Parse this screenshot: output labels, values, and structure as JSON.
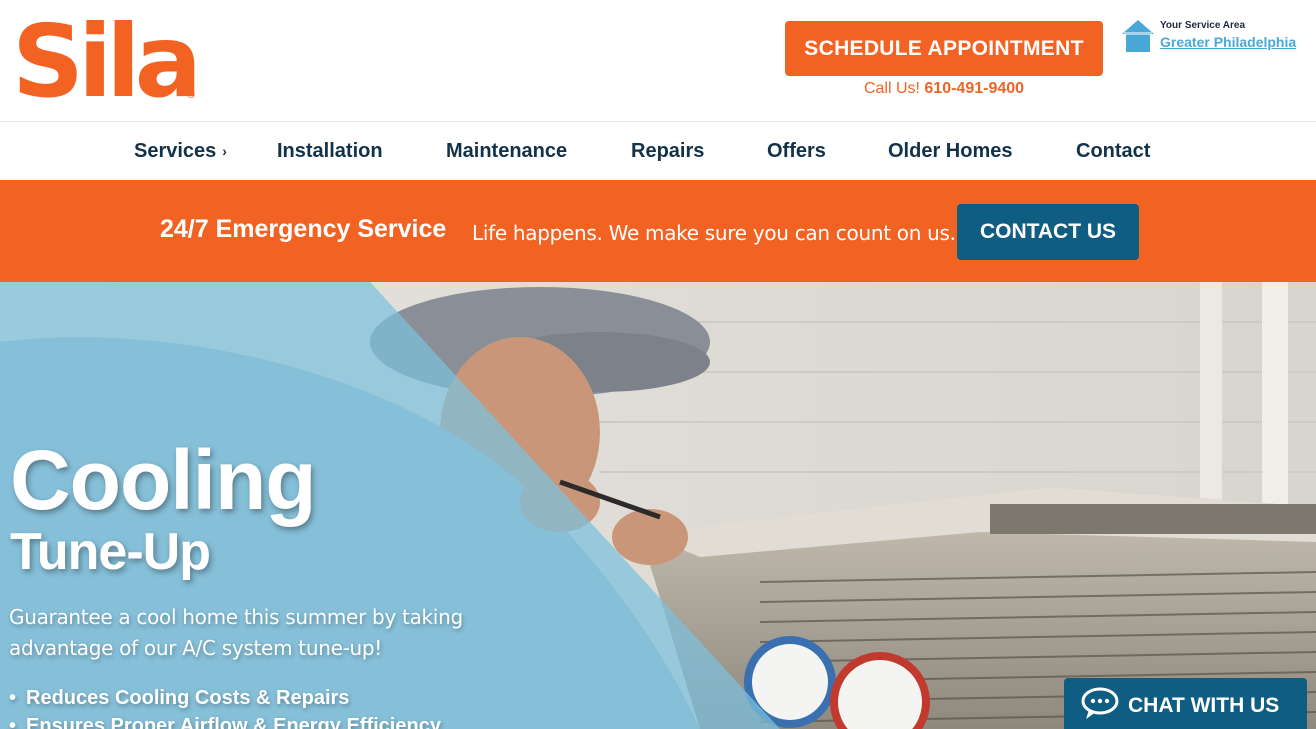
{
  "header": {
    "logo_text": "Sila",
    "schedule_label": "SCHEDULE APPOINTMENT",
    "call_prefix": "Call Us!",
    "phone": "610-491-9400",
    "area_label": "Your Service Area",
    "area_value": "Greater Philadelphia"
  },
  "nav": {
    "items": [
      {
        "label": "Services"
      },
      {
        "label": "Installation"
      },
      {
        "label": "Maintenance"
      },
      {
        "label": "Repairs"
      },
      {
        "label": "Offers"
      },
      {
        "label": "Older Homes"
      },
      {
        "label": "Contact"
      }
    ],
    "services_chevron": "›"
  },
  "banner": {
    "title": "24/7 Emergency Service",
    "text": "Life happens. We make sure you can count on us.",
    "contact_label": "CONTACT US"
  },
  "hero": {
    "title": "Cooling",
    "subtitle": "Tune-Up",
    "description": "Guarantee a cool home this summer by taking advantage of our A/C system tune-up!",
    "bullets": [
      "Reduces Cooling Costs & Repairs",
      "Ensures Proper Airflow & Energy Efficiency"
    ]
  },
  "chat": {
    "label": "CHAT WITH US",
    "icon": "chat-bubble-icon"
  },
  "colors": {
    "brand_orange": "#f26323",
    "brand_blue": "#0f5d82",
    "nav_text": "#12324a",
    "link_blue": "#4aa8d6",
    "overlay_blue": "#7cc0dd"
  }
}
